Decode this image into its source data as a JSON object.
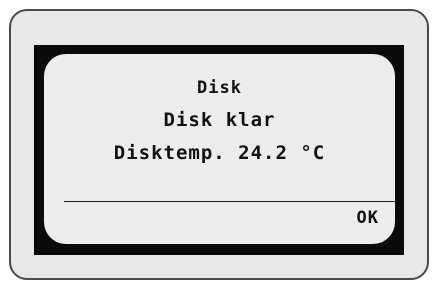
{
  "display": {
    "title": "Disk",
    "status": "Disk klar",
    "temperature": "Disktemp. 24.2 °C"
  },
  "softkeys": {
    "ok_label": "OK"
  },
  "colors": {
    "device_body": "#e8e8e8",
    "bezel": "#0a0a0a",
    "screen": "#ececec",
    "text": "#111111"
  }
}
